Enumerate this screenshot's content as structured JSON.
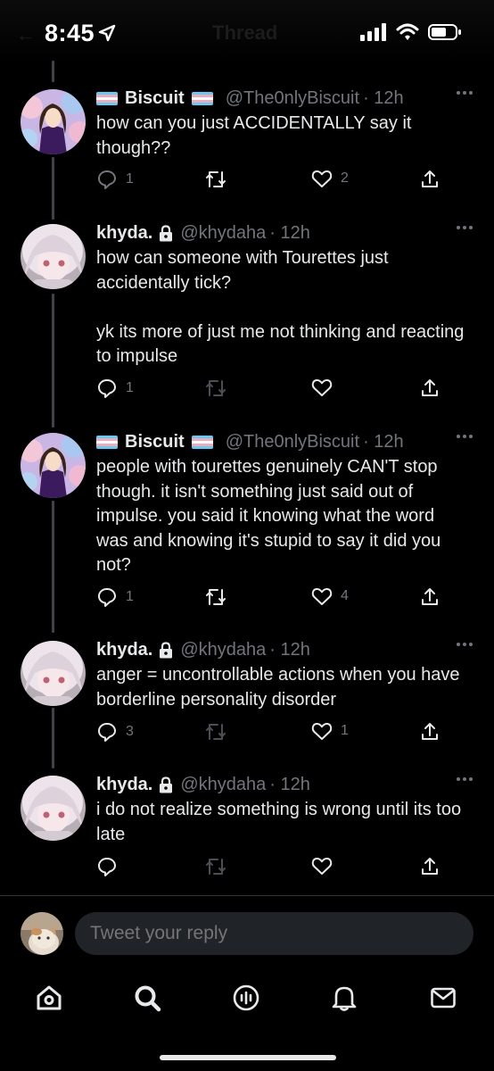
{
  "status": {
    "time": "8:45",
    "ghost_title": "Thread"
  },
  "tweets": [
    {
      "name": "Biscuit",
      "flags": true,
      "locked": false,
      "handle": "@The0nlyBiscuit",
      "time": "· 12h",
      "text": "how can you just ACCIDENTALLY say it though??",
      "replies": "1",
      "retweets": "",
      "likes": "2"
    },
    {
      "name": "khyda.",
      "flags": false,
      "locked": true,
      "handle": "@khydaha",
      "time": "· 12h",
      "text": "how can someone with Tourettes just accidentally tick?\n\nyk its more of just me not thinking and reacting to impulse",
      "replies": "1",
      "retweets": "",
      "likes": ""
    },
    {
      "name": "Biscuit",
      "flags": true,
      "locked": false,
      "handle": "@The0nlyBiscuit",
      "time": "· 12h",
      "text": "people with tourettes genuinely CAN'T stop though. it isn't something just said out of impulse. you said it knowing what the word was and knowing it's stupid to say it did you not?",
      "replies": "1",
      "retweets": "",
      "likes": "4"
    },
    {
      "name": "khyda.",
      "flags": false,
      "locked": true,
      "handle": "@khydaha",
      "time": "· 12h",
      "text": "anger = uncontrollable actions when you have borderline personality disorder",
      "replies": "3",
      "retweets": "",
      "likes": "1"
    },
    {
      "name": "khyda.",
      "flags": false,
      "locked": true,
      "handle": "@khydaha",
      "time": "· 12h",
      "text": "i do not realize something is wrong until its too late",
      "replies": "",
      "retweets": "",
      "likes": ""
    }
  ],
  "reply_bar": {
    "placeholder": "Tweet your reply"
  },
  "tabs": [
    "home-icon",
    "search-icon",
    "spaces-icon",
    "notifications-icon",
    "messages-icon"
  ],
  "colors": {
    "background": "#000000",
    "text": "#e7e9ea",
    "muted": "#71767b",
    "retweet_active": "#e7e9ea",
    "input_bg": "#202327"
  }
}
